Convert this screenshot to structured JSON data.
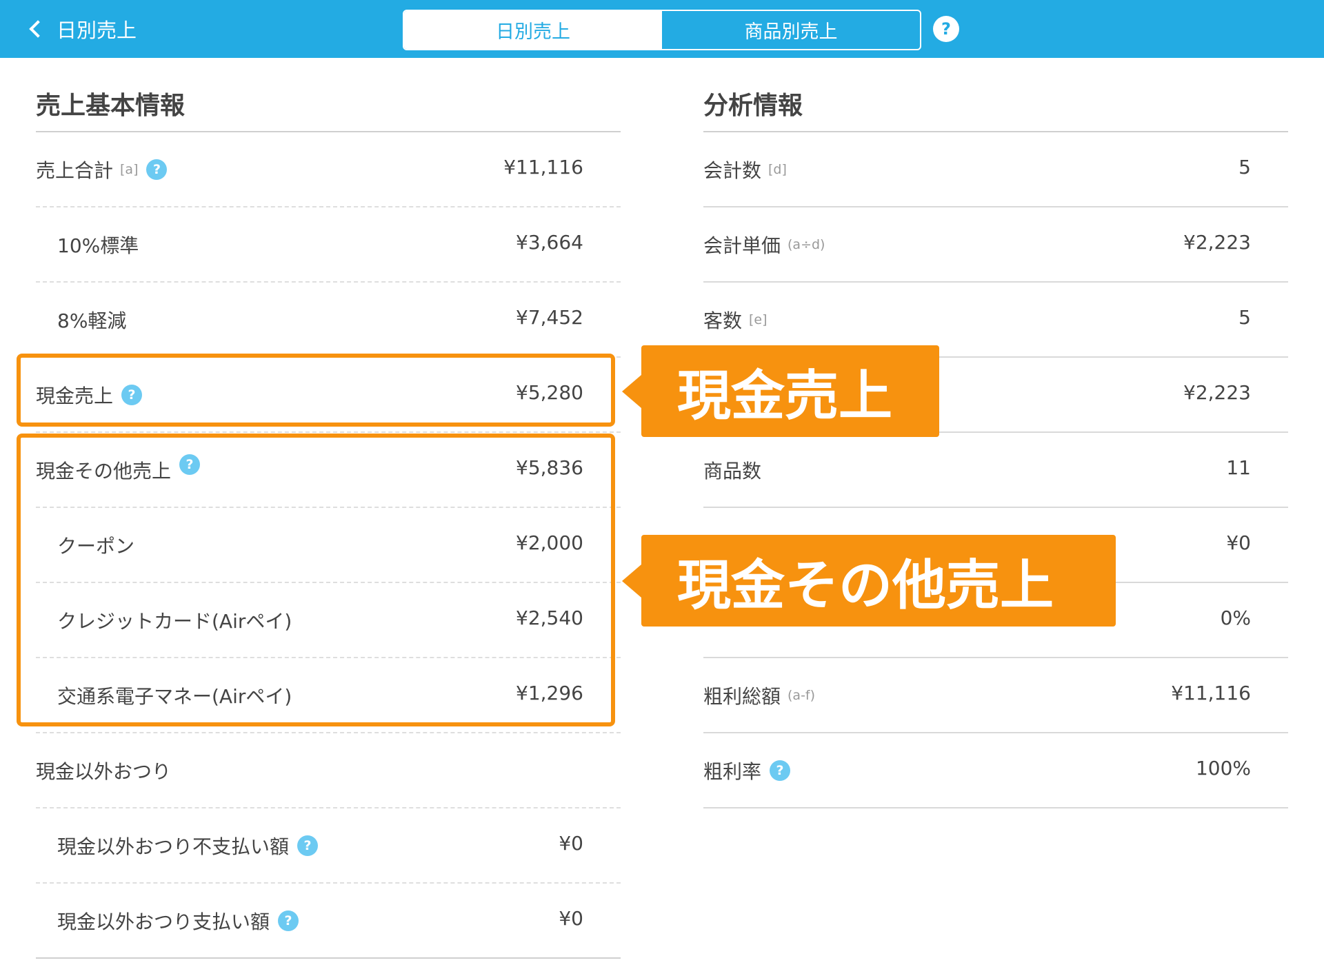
{
  "header": {
    "back_label": "日別売上",
    "tabs": [
      {
        "label": "日別売上",
        "active": true
      },
      {
        "label": "商品別売上",
        "active": false
      }
    ],
    "help_glyph": "?"
  },
  "left": {
    "title": "売上基本情報",
    "rows": [
      {
        "label": "売上合計",
        "tag": "[a]",
        "value": "¥11,116"
      },
      {
        "label": "10%標準",
        "value": "¥3,664"
      },
      {
        "label": "8%軽減",
        "value": "¥7,452"
      },
      {
        "label": "現金売上",
        "value": "¥5,280"
      },
      {
        "label": "現金その他売上",
        "value": "¥5,836"
      },
      {
        "label": "クーポン",
        "value": "¥2,000"
      },
      {
        "label": "クレジットカード(Airペイ)",
        "value": "¥2,540"
      },
      {
        "label": "交通系電子マネー(Airペイ)",
        "value": "¥1,296"
      },
      {
        "label": "現金以外おつり"
      },
      {
        "label": "現金以外おつり不支払い額",
        "value": "¥0"
      },
      {
        "label": "現金以外おつり支払い額",
        "value": "¥0"
      }
    ]
  },
  "right": {
    "title": "分析情報",
    "rows": [
      {
        "label": "会計数",
        "tag": "[d]",
        "value": "5"
      },
      {
        "label": "会計単価",
        "tag": "(a÷d)",
        "value": "¥2,223"
      },
      {
        "label": "客数",
        "tag": "[e]",
        "value": "5"
      },
      {
        "value": "¥2,223"
      },
      {
        "label": "商品数",
        "value": "11"
      },
      {
        "value": "¥0"
      },
      {
        "value": "0%"
      },
      {
        "label": "粗利総額",
        "tag": "(a-f)",
        "value": "¥11,116"
      },
      {
        "label": "粗利率",
        "value": "100%"
      }
    ]
  },
  "annotations": {
    "cash_sales": "現金売上",
    "other_cash_sales": "現金その他売上"
  },
  "colors": {
    "header_blue": "#23abe3",
    "help_blue": "#6ccaf2",
    "annotation_orange": "#f7920f"
  }
}
